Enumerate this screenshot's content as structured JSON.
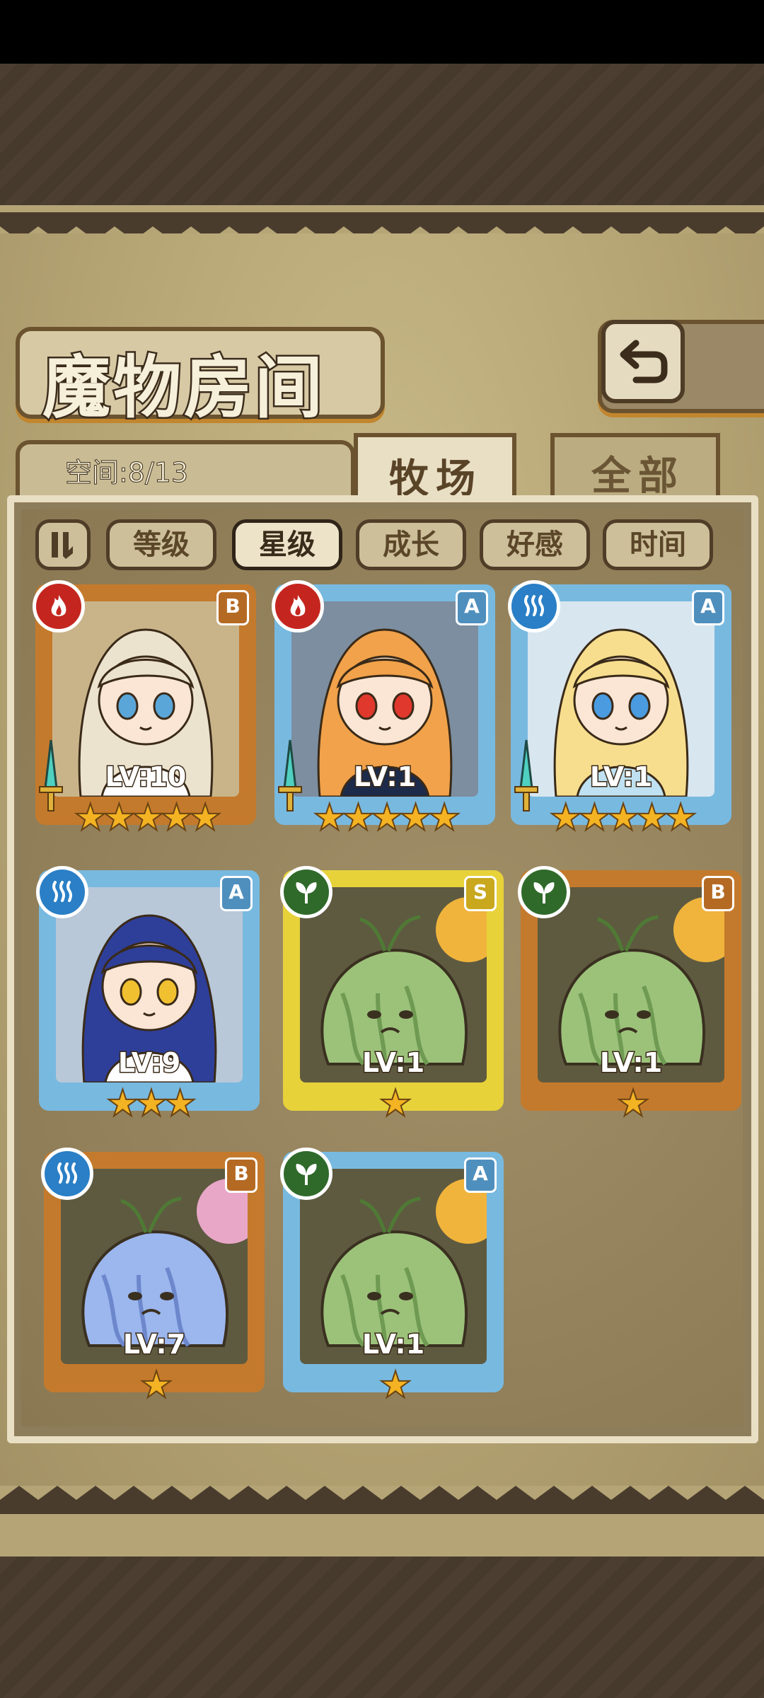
{
  "title": "魔物房间",
  "space_label": "空间:8/13",
  "tabs": [
    {
      "label": "牧场",
      "active": true
    },
    {
      "label": "全部",
      "active": false
    }
  ],
  "sort": {
    "buttons": [
      {
        "label": "等级",
        "active": false
      },
      {
        "label": "星级",
        "active": true
      },
      {
        "label": "成长",
        "active": false
      },
      {
        "label": "好感",
        "active": false
      },
      {
        "label": "时间",
        "active": false
      }
    ]
  },
  "cards": [
    {
      "level": "LV:10",
      "rank": "B",
      "element": "fire",
      "stars": 5,
      "frame": "bronze",
      "creature": "girl-captain"
    },
    {
      "level": "LV:1",
      "rank": "A",
      "element": "fire",
      "stars": 5,
      "frame": "blue",
      "creature": "girl-maid"
    },
    {
      "level": "LV:1",
      "rank": "A",
      "element": "water",
      "stars": 5,
      "frame": "blue",
      "creature": "girl-armor"
    },
    {
      "level": "LV:9",
      "rank": "A",
      "element": "water",
      "stars": 3,
      "frame": "blue",
      "creature": "girl-bell"
    },
    {
      "level": "LV:1",
      "rank": "S",
      "element": "wood",
      "stars": 1,
      "frame": "gold",
      "creature": "green-slime"
    },
    {
      "level": "LV:1",
      "rank": "B",
      "element": "wood",
      "stars": 1,
      "frame": "bronze",
      "creature": "green-slime"
    },
    {
      "level": "LV:7",
      "rank": "B",
      "element": "water",
      "stars": 1,
      "frame": "bronze",
      "creature": "blue-slime"
    },
    {
      "level": "LV:1",
      "rank": "A",
      "element": "wood",
      "stars": 1,
      "frame": "blue",
      "creature": "green-slime"
    }
  ],
  "colors": {
    "fire": "#c4261f",
    "water": "#2a7fc6",
    "wood": "#2f6a2a",
    "frame_bronze": "#c47a2c",
    "frame_blue": "#78b9e0",
    "frame_gold": "#e7d23a"
  },
  "icons": {
    "back": "back-arrow-icon",
    "sort_toggle": "sort-order-icon"
  }
}
